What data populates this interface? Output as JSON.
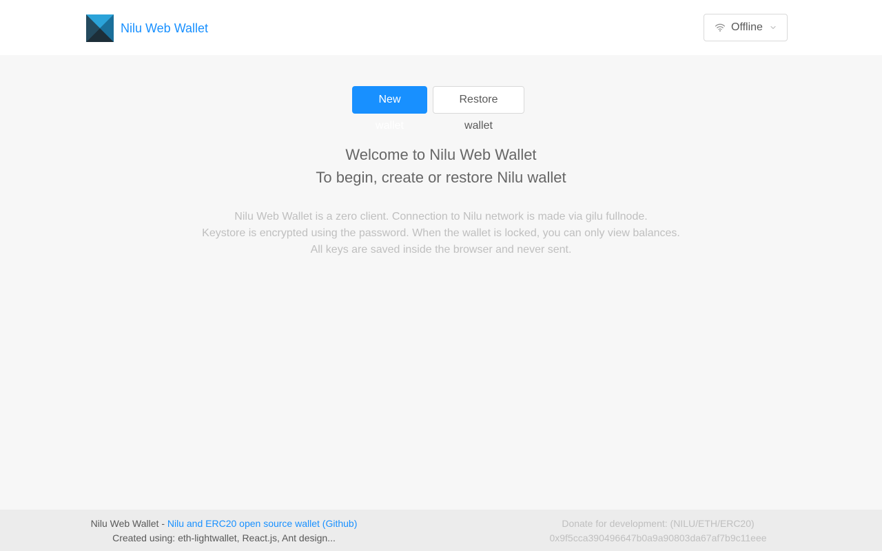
{
  "header": {
    "title": "Nilu Web Wallet",
    "logo": "nilu-logo-icon",
    "network": {
      "icon": "wifi-icon",
      "selected": "Offline"
    }
  },
  "actions": {
    "new_wallet": "New wallet",
    "restore_wallet": "Restore wallet"
  },
  "welcome": {
    "line1": "Welcome to Nilu Web Wallet",
    "line2": "To begin, create or restore Nilu wallet"
  },
  "info": {
    "line1": "Nilu Web Wallet is a zero client. Connection to Nilu network is made via gilu fullnode.",
    "line2": "Keystore is encrypted using the password. When the wallet is locked, you can only view balances.",
    "line3": "All keys are saved inside the browser and never sent."
  },
  "footer": {
    "app_name": "Nilu Web Wallet",
    "separator": " - ",
    "github_link": "Nilu and ERC20 open source wallet (Github)",
    "created_using": "Created using: eth-lightwallet, React.js, Ant design...",
    "donate_label": "Donate for development: (NILU/ETH/ERC20)",
    "donate_address": "0x9f5cca390496647b0a9a90803da67af7b9c11eee"
  },
  "colors": {
    "accent": "#1890ff",
    "background": "#f7f7f7",
    "footer_bg": "#ececec"
  }
}
